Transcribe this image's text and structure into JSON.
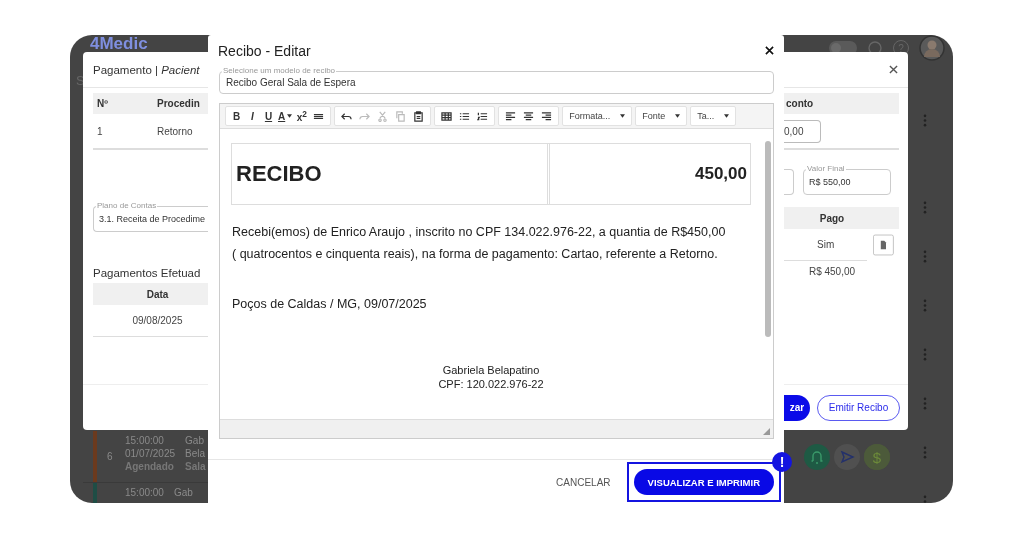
{
  "app_background": {
    "logo": "4Medic",
    "sidebar_letter": "S",
    "help_label": "?",
    "toggle": {
      "on": false
    },
    "rows": [
      {
        "number": "6",
        "time": "15:00:00",
        "date": "01/07/2025",
        "status": "Agendado",
        "person": [
          "Gab",
          "Bela"
        ],
        "room": "Sala",
        "color": "#6b3a1e"
      },
      {
        "time": "15:00:00",
        "person": [
          "Gab"
        ],
        "color": "#1f4d45"
      }
    ],
    "action_buttons": [
      {
        "kind": "bell"
      },
      {
        "kind": "send"
      },
      {
        "kind": "dollar",
        "label": "$"
      }
    ]
  },
  "payment_dialog": {
    "title": "Pagamento | *Pacient*",
    "table": {
      "columns": [
        "Nº",
        "Procedin"
      ],
      "rows": [
        {
          "cells": [
            "1",
            "Retorno"
          ]
        }
      ]
    },
    "discount_column": {
      "header": "conto",
      "value": "0,00"
    },
    "plan_field": {
      "label": "Plano de Contas",
      "value": "3.1. Receita de Procedime"
    },
    "final_value_field": {
      "label": "Valor Final",
      "value": "R$ 550,00"
    },
    "payments_title": "Pagamentos Efetuad",
    "payments_table": {
      "date_header": "Data",
      "paid_header": "Pago",
      "rows": [
        {
          "date": "09/08/2025",
          "paid": "Sim"
        }
      ],
      "total": "R$ 450,00"
    },
    "buttons": [
      {
        "label": "zar",
        "kind": "primary"
      },
      {
        "label": "Emitir Recibo",
        "kind": "outline"
      }
    ]
  },
  "receipt_dialog": {
    "title": "Recibo - Editar",
    "template_select": {
      "label": "Selecione um modelo de recibo",
      "value": "Recibo Geral Sala de Espera"
    },
    "toolbar": [
      {
        "items": [
          {
            "kind": "bold",
            "label": "B"
          },
          {
            "kind": "italic",
            "label": "I"
          },
          {
            "kind": "underline",
            "label": "U"
          },
          {
            "kind": "color",
            "label": "A"
          },
          {
            "kind": "superscript",
            "label": "x$^{2}$"
          },
          {
            "kind": "rule"
          }
        ]
      },
      {
        "items": [
          {
            "kind": "undo",
            "disabled": false
          },
          {
            "kind": "redo",
            "disabled": true
          },
          {
            "kind": "cut",
            "disabled": true
          },
          {
            "kind": "copy",
            "disabled": true
          },
          {
            "kind": "paste",
            "disabled": false
          }
        ]
      },
      {
        "items": [
          {
            "kind": "table"
          },
          {
            "kind": "bullets"
          },
          {
            "kind": "numbers"
          }
        ]
      },
      {
        "items": [
          {
            "kind": "align-left"
          },
          {
            "kind": "align-center"
          },
          {
            "kind": "align-right"
          }
        ]
      },
      {
        "items": [
          {
            "kind": "dropdown",
            "label": "Formata..."
          }
        ]
      },
      {
        "items": [
          {
            "kind": "dropdown",
            "label": "Fonte"
          }
        ]
      },
      {
        "items": [
          {
            "kind": "dropdown",
            "label": "Ta..."
          }
        ]
      }
    ],
    "document": {
      "heading": "RECIBO",
      "amount": "450,00",
      "paragraph": "Recebi(emos) de Enrico Araujo , inscrito no CPF 134.022.976-22, a quantia de R$450,00 ( quatrocentos e cinquenta reais), na forma de pagamento: Cartao, referente a Retorno.",
      "place_date": "Poços de Caldas / MG, 09/07/2025",
      "signature": [
        "Gabriela Belapatino",
        "CPF: 120.022.976-22"
      ]
    },
    "buttons": [
      {
        "label": "CANCELAR",
        "kind": "text",
        "highlighted": false
      },
      {
        "label": "VISUALIZAR E IMPRIMIR",
        "kind": "primary",
        "highlighted": true
      }
    ],
    "highlight_badge": "!"
  }
}
